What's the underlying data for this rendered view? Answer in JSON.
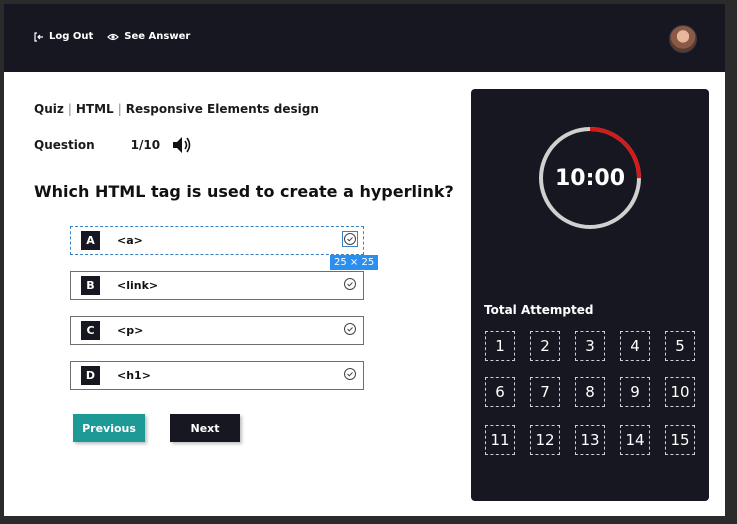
{
  "header": {
    "logout_label": "Log Out",
    "see_answer_label": "See Answer"
  },
  "breadcrumb": {
    "items": [
      "Quiz",
      "HTML",
      "Responsive Elements design"
    ]
  },
  "question_meta": {
    "label": "Question",
    "counter": "1/10"
  },
  "question": {
    "text": "Which HTML tag is used to create a hyperlink?"
  },
  "options": [
    {
      "letter": "A",
      "text": "<a>"
    },
    {
      "letter": "B",
      "text": "<link>"
    },
    {
      "letter": "C",
      "text": "<p>"
    },
    {
      "letter": "D",
      "text": "<h1>"
    }
  ],
  "selection_size_tag": "25 × 25",
  "buttons": {
    "previous": "Previous",
    "next": "Next"
  },
  "timer": {
    "display": "10:00",
    "progress_fraction": 0.25,
    "ring_color": "#d0d0d0",
    "progress_color": "#d51a1a"
  },
  "attempted": {
    "label": "Total Attempted",
    "numbers": [
      "1",
      "2",
      "3",
      "4",
      "5",
      "6",
      "7",
      "8",
      "9",
      "10",
      "11",
      "12",
      "13",
      "14",
      "15"
    ]
  },
  "colors": {
    "dark": "#171722",
    "accent_teal": "#1d9a96"
  }
}
